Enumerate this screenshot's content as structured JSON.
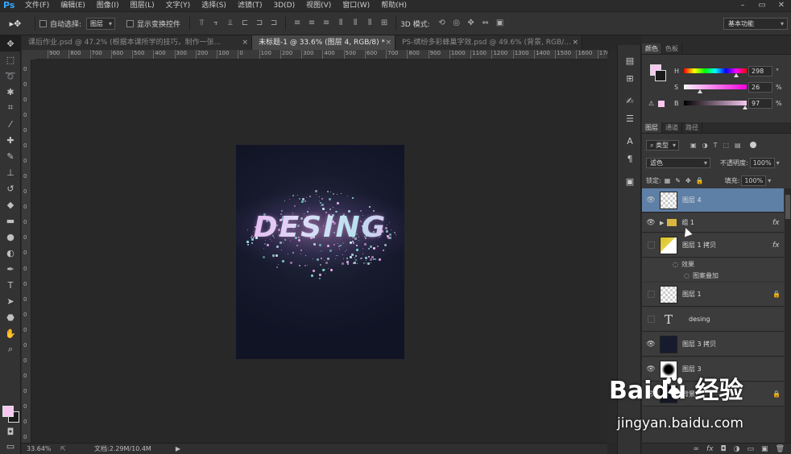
{
  "app": {
    "logo": "Ps"
  },
  "menu": [
    "文件(F)",
    "编辑(E)",
    "图像(I)",
    "图层(L)",
    "文字(Y)",
    "选择(S)",
    "滤镜(T)",
    "3D(D)",
    "视图(V)",
    "窗口(W)",
    "帮助(H)"
  ],
  "window_controls": {
    "minimize": "–",
    "restore": "▭",
    "close": "✕"
  },
  "options": {
    "tool_glyph": "▸✥",
    "auto_select_label": "自动选择:",
    "auto_select_value": "图层",
    "show_transform_label": "显示变换控件",
    "mode_3d_label": "3D 模式:",
    "workspace": "基本功能"
  },
  "tabs": [
    {
      "label": "课后作业.psd @ 47.2% (根据本课所学的技巧，制作一张...",
      "close": "×"
    },
    {
      "label": "未标题-1 @ 33.6% (图层 4, RGB/8) *",
      "close": "×",
      "active": true
    },
    {
      "label": "PS-缤纷多彩蜂巢字效.psd @ 49.6% (背景, RGB/...",
      "close": "×"
    }
  ],
  "ruler_h": [
    "900",
    "800",
    "700",
    "600",
    "500",
    "400",
    "300",
    "200",
    "100",
    "0",
    "100",
    "200",
    "300",
    "400",
    "500",
    "600",
    "700",
    "800",
    "900",
    "1000",
    "1100",
    "1200",
    "1300",
    "1400",
    "1500",
    "1600",
    "1700"
  ],
  "ruler_v": [
    "0",
    "0",
    "0",
    "0",
    "0",
    "0",
    "0",
    "0",
    "0",
    "0",
    "0",
    "0",
    "0",
    "0",
    "0",
    "0",
    "0",
    "0",
    "0",
    "0",
    "0",
    "0",
    "0",
    "0",
    "0"
  ],
  "canvas": {
    "artwork_text": "DESING"
  },
  "status": {
    "zoom": "33.64%",
    "doc_size": "文档:2.29M/10.4M",
    "arrow": "▶"
  },
  "color_panel": {
    "tabs": [
      "颜色",
      "色板"
    ],
    "h_label": "H",
    "h_value": "298",
    "h_unit": "°",
    "s_label": "S",
    "s_value": "26",
    "s_unit": "%",
    "b_label": "B",
    "b_value": "97",
    "b_unit": "%",
    "h_level": 0.83,
    "s_level": 0.26,
    "b_level": 0.97,
    "fg_color": "#f7c8f0"
  },
  "layers_panel": {
    "tabs": [
      "图层",
      "通道",
      "路径"
    ],
    "filter_kind": "类型",
    "blend_mode": "滤色",
    "opacity_label": "不透明度:",
    "opacity_value": "100%",
    "lock_label": "锁定:",
    "fill_label": "填充:",
    "fill_value": "100%",
    "layers": [
      {
        "name": "图层 4",
        "visible": true,
        "selected": true
      },
      {
        "name": "组 1",
        "visible": true,
        "group": true,
        "fx": "fx"
      },
      {
        "name": "图层 1 拷贝",
        "visible": false,
        "fx": "fx"
      },
      {
        "name": "效果",
        "sub": true
      },
      {
        "name": "图案叠加",
        "sub": true
      },
      {
        "name": "图层 1",
        "visible": false,
        "lock": "🔒"
      },
      {
        "name": "desing",
        "visible": false,
        "text": true
      },
      {
        "name": "图层 3 拷贝",
        "visible": true
      },
      {
        "name": "图层 3",
        "visible": true
      },
      {
        "name": "背景",
        "visible": true,
        "lock": "🔒"
      }
    ],
    "bottom_icons": [
      "∞",
      "fx",
      "◘",
      "◑",
      "▭",
      "▣",
      "🗑"
    ]
  },
  "watermark": {
    "logo_text": "Baidu 经验",
    "url": "jingyan.baidu.com"
  }
}
